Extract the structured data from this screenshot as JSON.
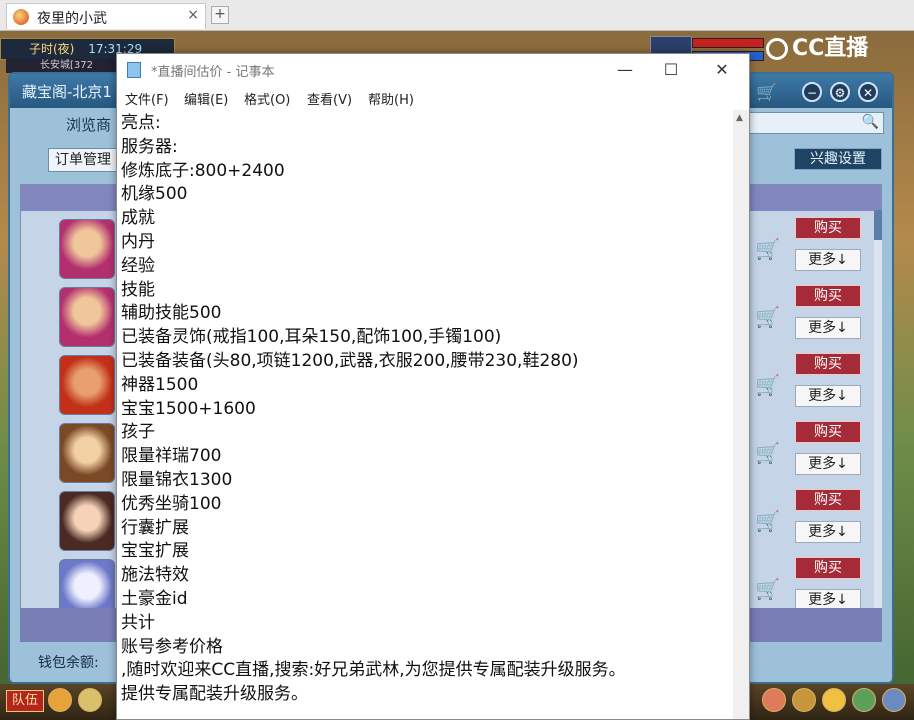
{
  "browser": {
    "tab_title": "夜里的小武",
    "tab_close": "×",
    "new_tab": "+"
  },
  "game": {
    "clock_label": "子时(夜)",
    "clock_time": "17:31:29",
    "location": "长安城[372",
    "cc_logo": "CC直播",
    "panel_title": "藏宝阁-北京1",
    "browse_label": "浏览商",
    "order_manage": "订单管理",
    "interest_settings": "兴趣设置",
    "wallet_label": "钱包余额:",
    "team_label": "队伍",
    "buy_label": "购买",
    "more_label": "更多↓"
  },
  "notepad": {
    "window_title": "*直播间估价 - 记事本",
    "menu": [
      "文件(F)",
      "编辑(E)",
      "格式(O)",
      "查看(V)",
      "帮助(H)"
    ],
    "lines": [
      "亮点:",
      "服务器:",
      "修炼底子:800+2400",
      "机缘500",
      "成就",
      "内丹",
      "经验",
      "技能",
      "辅助技能500",
      "已装备灵饰(戒指100,耳朵150,配饰100,手镯100)",
      "已装备装备(头80,项链1200,武器,衣服200,腰带230,鞋280)",
      "神器1500",
      "宝宝1500+1600",
      "孩子",
      "限量祥瑞700",
      "限量锦衣1300",
      "优秀坐骑100",
      "行囊扩展",
      "宝宝扩展",
      "施法特效",
      "土豪金id",
      "共计",
      "账号参考价格",
      ",随时欢迎来CC直播,搜索:好兄弟武林,为您提供专属配装升级服务。",
      "提供专属配装升级服务。"
    ]
  }
}
